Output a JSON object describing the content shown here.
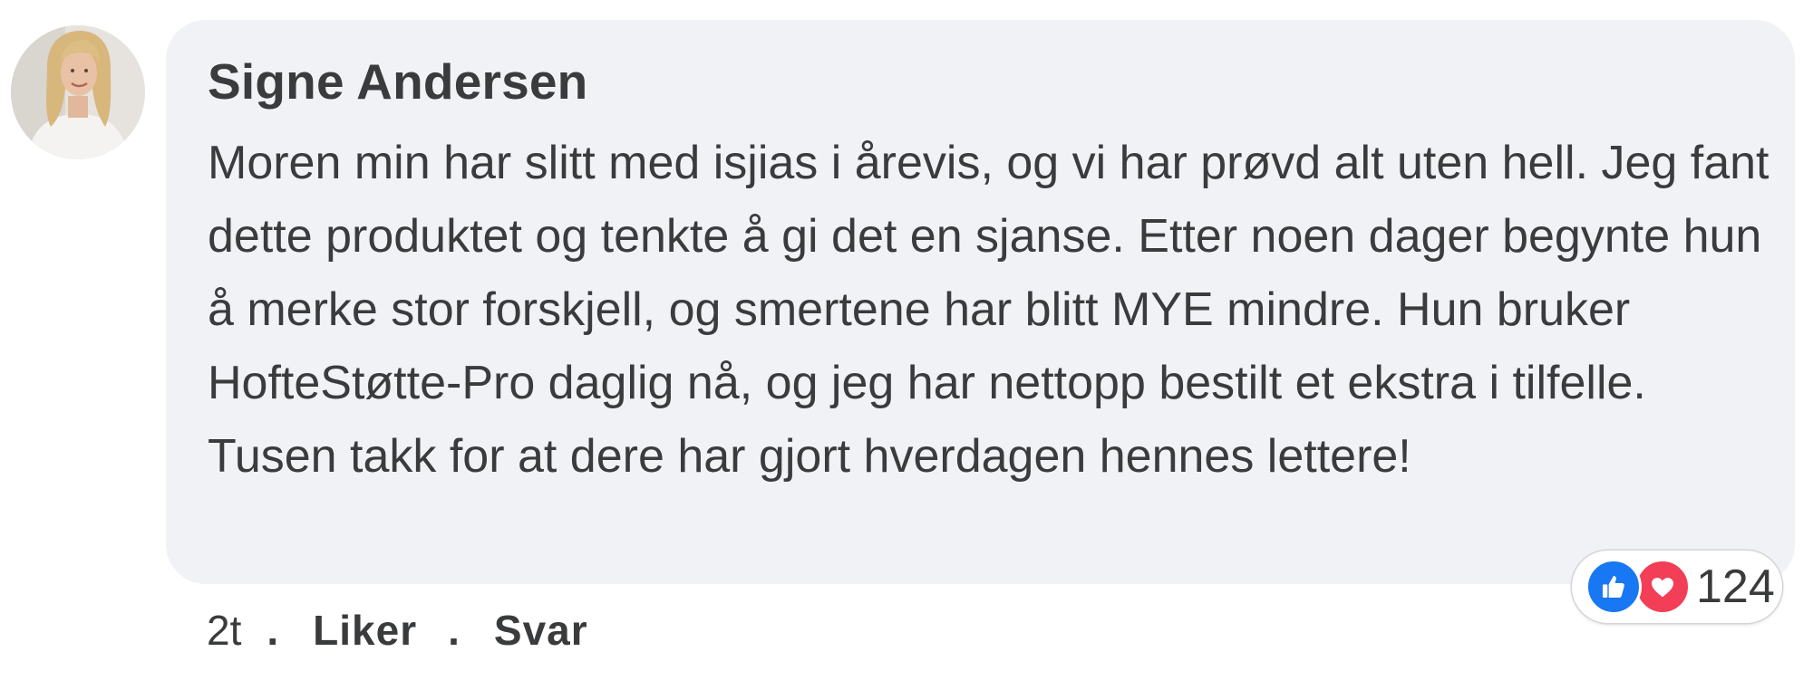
{
  "comment": {
    "author": "Signe Andersen",
    "text": "Moren min har slitt med isjias i årevis, og vi har prøvd alt uten hell. Jeg fant dette produktet og tenkte å gi det en sjanse. Etter noen dager begynte hun å merke stor forskjell, og smertene har blitt MYE mindre. Hun bruker HofteStøtte-Pro daglig nå, og jeg har nettopp bestilt et ekstra i tilfelle. Tusen takk for at dere har gjort hverdagen hennes lettere!",
    "timestamp": "2t",
    "separator": ".",
    "like_label": "Liker",
    "reply_label": "Svar"
  },
  "reactions": {
    "icons": [
      "like-icon",
      "love-icon"
    ],
    "count": "124"
  },
  "colors": {
    "bubble_background": "#f0f2f5",
    "text": "#3a3b3c",
    "like_blue": "#1877f2",
    "love_red": "#f33e58"
  }
}
